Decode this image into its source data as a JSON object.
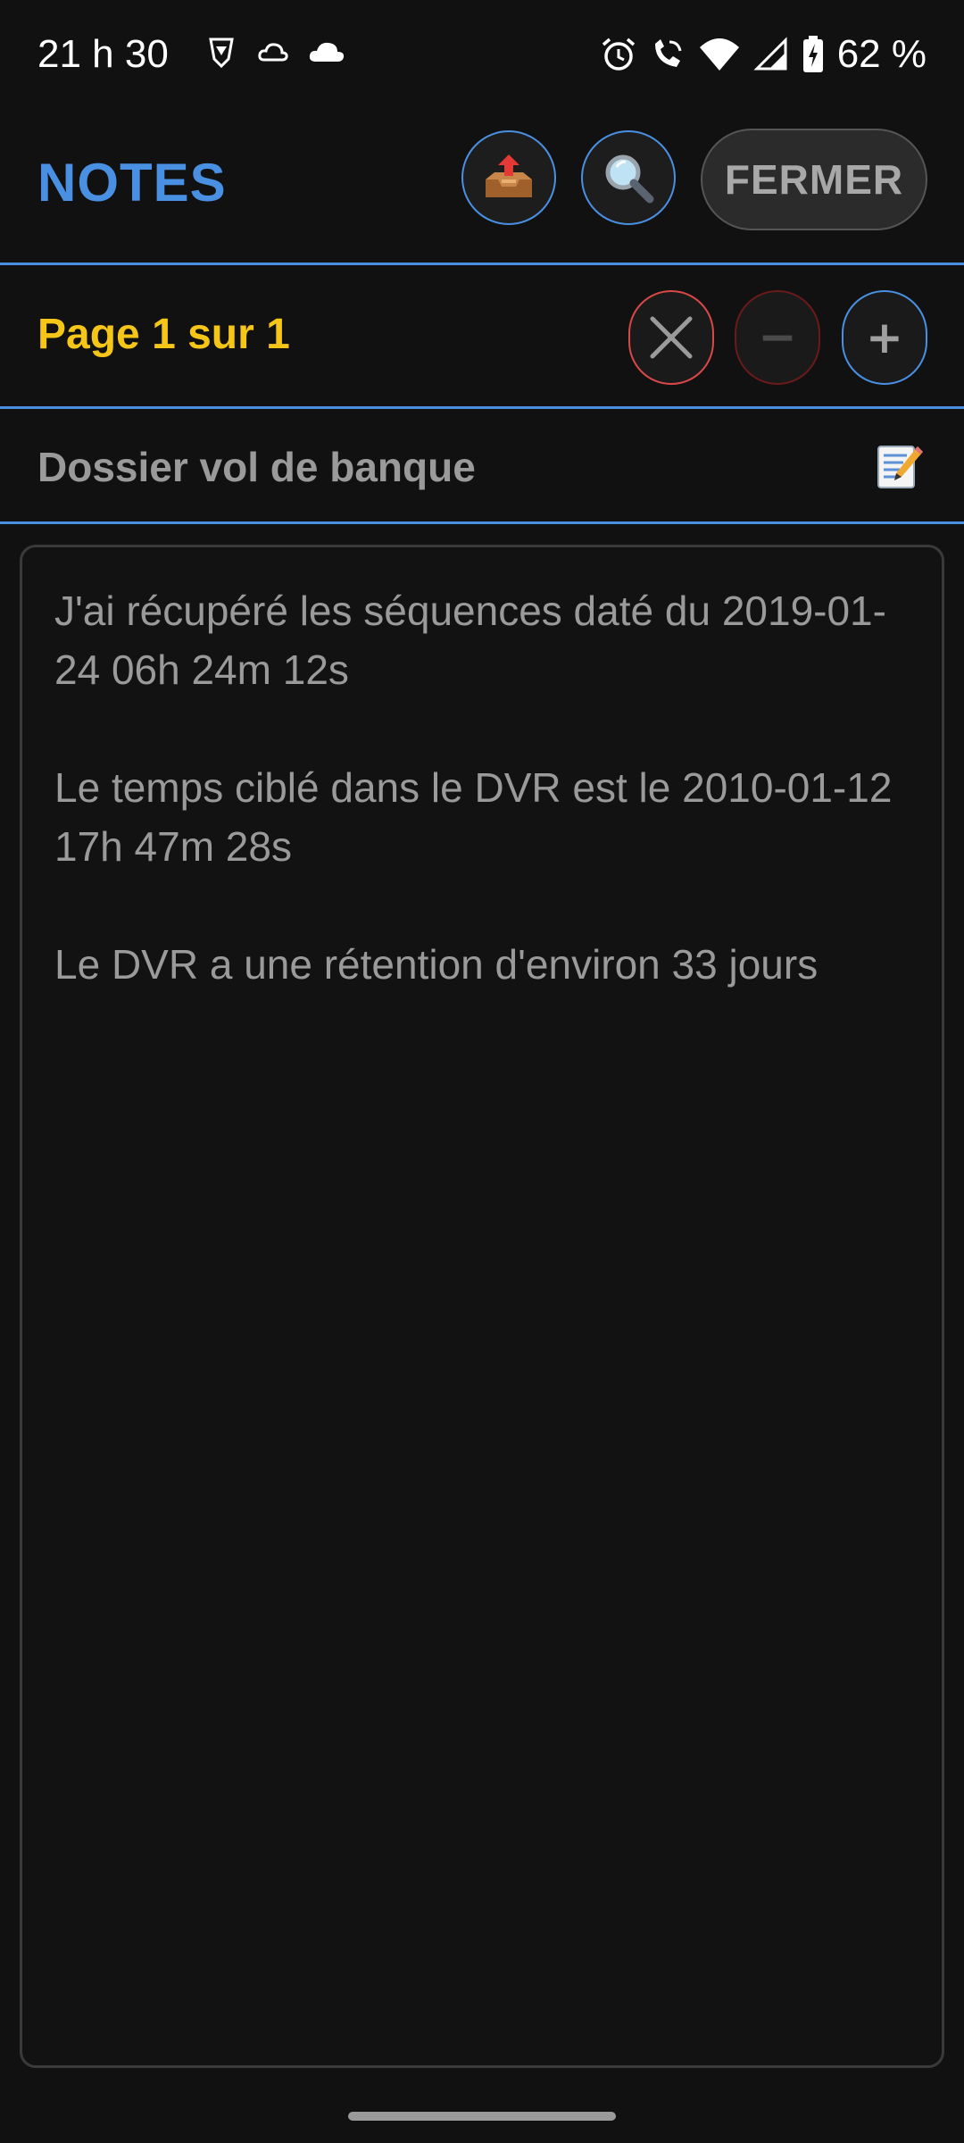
{
  "status_bar": {
    "time": "21 h 30",
    "battery": "62 %",
    "icons": [
      "brave-icon",
      "cloud-outline-icon",
      "cloud-icon",
      "alarm-icon",
      "wifi-call-icon",
      "wifi-icon",
      "signal-icon",
      "battery-charging-icon"
    ]
  },
  "header": {
    "title": "NOTES",
    "export_icon": "outbox-tray-icon",
    "search_icon": "magnifier-icon",
    "close_label": "FERMER"
  },
  "page_bar": {
    "indicator": "Page 1 sur 1",
    "minus_label": "−",
    "plus_label": "+"
  },
  "note": {
    "title": "Dossier vol de banque",
    "paragraphs": [
      "J'ai récupéré les séquences daté du 2019-01-24 06h 24m 12s",
      "Le temps ciblé dans le DVR est le 2010-01-12 17h 47m 28s",
      "Le DVR a une rétention d'environ 33 jours"
    ]
  },
  "colors": {
    "accent": "#4a90e2",
    "page_indicator": "#f5c518",
    "delete": "#d94848",
    "background": "#111111"
  }
}
